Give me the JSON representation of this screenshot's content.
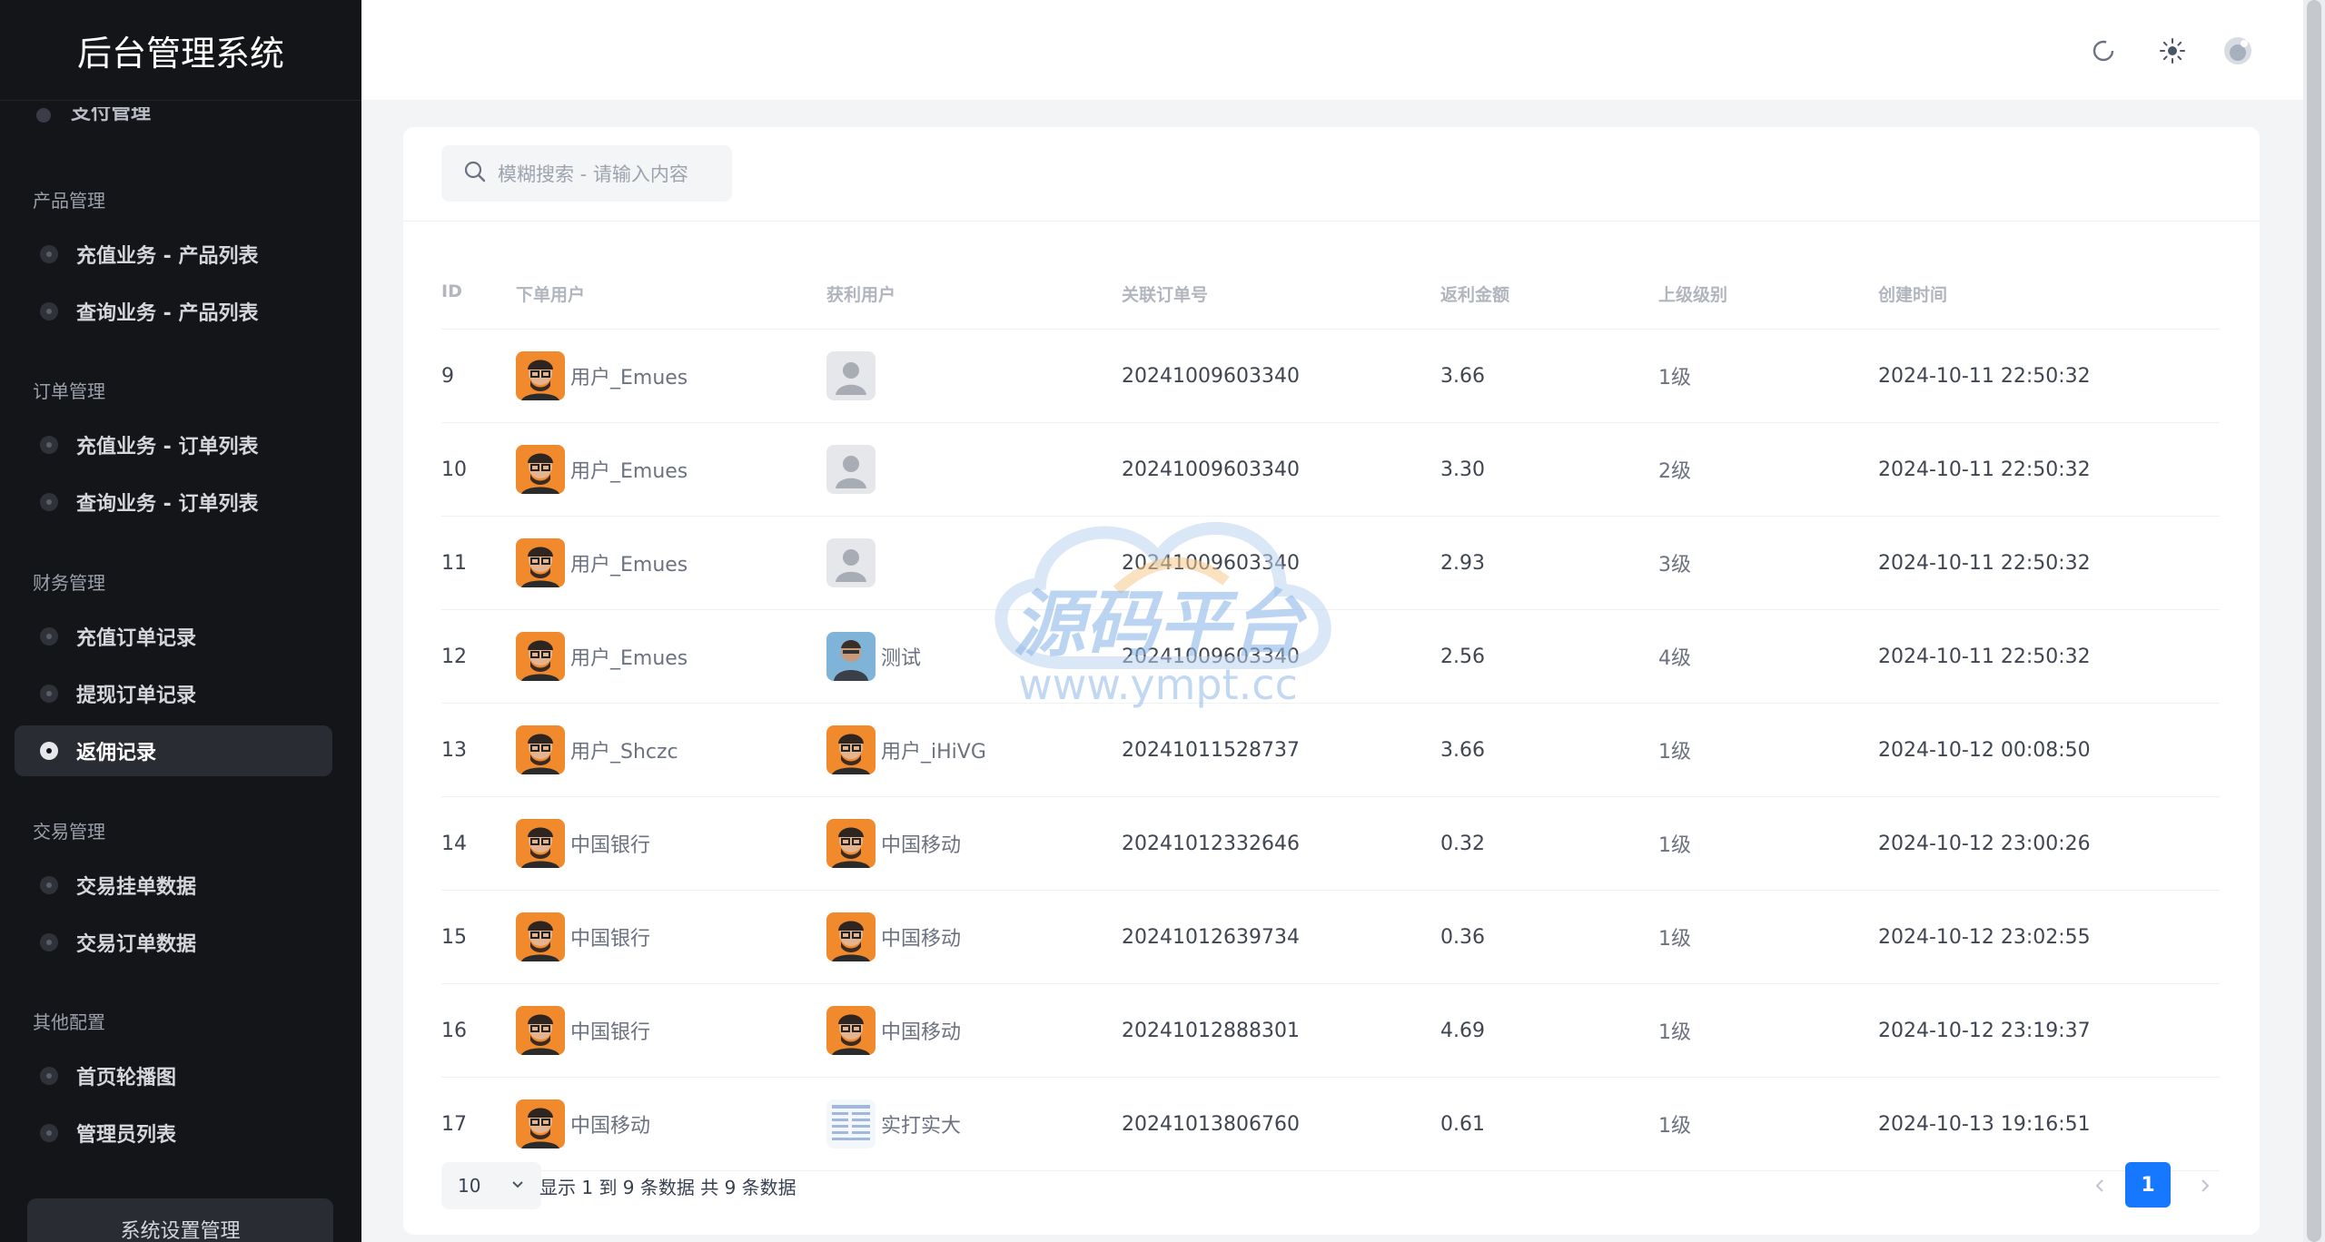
{
  "app": {
    "title": "后台管理系统"
  },
  "sidebar": {
    "cut_item": "支付管理",
    "groups": [
      {
        "label": "产品管理",
        "items": [
          "充值业务 - 产品列表",
          "查询业务 - 产品列表"
        ]
      },
      {
        "label": "订单管理",
        "items": [
          "充值业务 - 订单列表",
          "查询业务 - 订单列表"
        ]
      },
      {
        "label": "财务管理",
        "items": [
          "充值订单记录",
          "提现订单记录",
          "返佣记录"
        ]
      },
      {
        "label": "交易管理",
        "items": [
          "交易挂单数据",
          "交易订单数据"
        ]
      },
      {
        "label": "其他配置",
        "items": [
          "首页轮播图",
          "管理员列表"
        ]
      }
    ],
    "active_item": "返佣记录",
    "settings_label": "系统设置管理"
  },
  "header": {
    "icons": [
      "refresh-icon",
      "theme-sun-icon",
      "avatar-icon"
    ]
  },
  "search": {
    "placeholder": "模糊搜索 - 请输入内容"
  },
  "table": {
    "columns": [
      "ID",
      "下单用户",
      "获利用户",
      "关联订单号",
      "返利金额",
      "上级级别",
      "创建时间"
    ],
    "rows": [
      {
        "id": "9",
        "buyer": "用户_Emues",
        "buyer_avatar": "orange",
        "earner": "",
        "earner_avatar": "default",
        "order_no": "20241009603340",
        "amount": "3.66",
        "level": "1级",
        "created": "2024-10-11 22:50:32"
      },
      {
        "id": "10",
        "buyer": "用户_Emues",
        "buyer_avatar": "orange",
        "earner": "",
        "earner_avatar": "default",
        "order_no": "20241009603340",
        "amount": "3.30",
        "level": "2级",
        "created": "2024-10-11 22:50:32"
      },
      {
        "id": "11",
        "buyer": "用户_Emues",
        "buyer_avatar": "orange",
        "earner": "",
        "earner_avatar": "default",
        "order_no": "20241009603340",
        "amount": "2.93",
        "level": "3级",
        "created": "2024-10-11 22:50:32"
      },
      {
        "id": "12",
        "buyer": "用户_Emues",
        "buyer_avatar": "orange",
        "earner": "测试",
        "earner_avatar": "photo",
        "order_no": "20241009603340",
        "amount": "2.56",
        "level": "4级",
        "created": "2024-10-11 22:50:32"
      },
      {
        "id": "13",
        "buyer": "用户_Shczc",
        "buyer_avatar": "orange",
        "earner": "用户_iHiVG",
        "earner_avatar": "orange",
        "order_no": "20241011528737",
        "amount": "3.66",
        "level": "1级",
        "created": "2024-10-12 00:08:50"
      },
      {
        "id": "14",
        "buyer": "中国银行",
        "buyer_avatar": "orange",
        "earner": "中国移动",
        "earner_avatar": "orange",
        "order_no": "20241012332646",
        "amount": "0.32",
        "level": "1级",
        "created": "2024-10-12 23:00:26"
      },
      {
        "id": "15",
        "buyer": "中国银行",
        "buyer_avatar": "orange",
        "earner": "中国移动",
        "earner_avatar": "orange",
        "order_no": "20241012639734",
        "amount": "0.36",
        "level": "1级",
        "created": "2024-10-12 23:02:55"
      },
      {
        "id": "16",
        "buyer": "中国银行",
        "buyer_avatar": "orange",
        "earner": "中国移动",
        "earner_avatar": "orange",
        "order_no": "20241012888301",
        "amount": "4.69",
        "level": "1级",
        "created": "2024-10-12 23:19:37"
      },
      {
        "id": "17",
        "buyer": "中国移动",
        "buyer_avatar": "orange",
        "earner": "实打实大",
        "earner_avatar": "doc",
        "order_no": "20241013806760",
        "amount": "0.61",
        "level": "1级",
        "created": "2024-10-13 19:16:51"
      }
    ]
  },
  "pagination": {
    "page_size": "10",
    "summary": "显示 1 到 9 条数据 共 9 条数据",
    "current_page": "1"
  },
  "watermark": {
    "text": "源码平台",
    "url": "www.ympt.cc"
  },
  "colors": {
    "accent": "#1677ff",
    "sidebar_bg": "#141518",
    "watermark": "#9ec2ec"
  }
}
